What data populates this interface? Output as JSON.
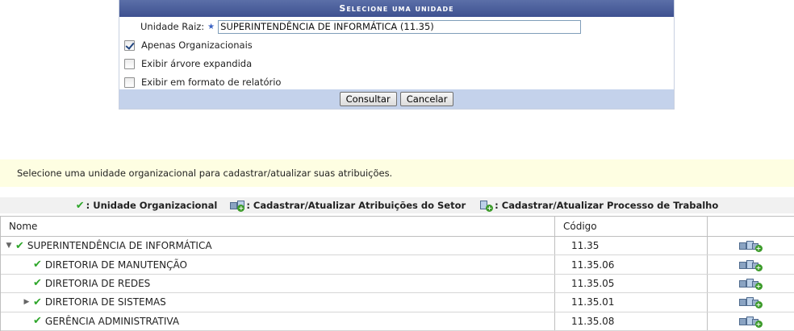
{
  "form": {
    "caption": "Selecione uma unidade",
    "root_label": "Unidade Raiz:",
    "required_mark": "★",
    "root_value": "SUPERINTENDÊNCIA DE INFORMÁTICA (11.35)",
    "options": [
      {
        "label": "Apenas Organizacionais",
        "checked": true
      },
      {
        "label": "Exibir árvore expandida",
        "checked": false
      },
      {
        "label": "Exibir em formato de relatório",
        "checked": false
      }
    ],
    "buttons": {
      "consult": "Consultar",
      "cancel": "Cancelar"
    }
  },
  "info": {
    "message": "Selecione uma unidade organizacional para cadastrar/atualizar suas atribuições."
  },
  "legend": {
    "org_unit": ": Unidade Organizacional",
    "sector_attr": ": Cadastrar/Atualizar Atribuições do Setor",
    "work_process": ": Cadastrar/Atualizar Processo de Trabalho"
  },
  "table": {
    "headers": {
      "name": "Nome",
      "code": "Código"
    },
    "rows": [
      {
        "expander": "▼",
        "name": "SUPERINTENDÊNCIA DE INFORMÁTICA",
        "code": "11.35",
        "level": 0
      },
      {
        "expander": "",
        "name": "DIRETORIA DE MANUTENÇÃO",
        "code": "11.35.06",
        "level": 1
      },
      {
        "expander": "",
        "name": "DIRETORIA DE REDES",
        "code": "11.35.05",
        "level": 1
      },
      {
        "expander": "▶",
        "name": "DIRETORIA DE SISTEMAS",
        "code": "11.35.01",
        "level": 1
      },
      {
        "expander": "",
        "name": "GERÊNCIA ADMINISTRATIVA",
        "code": "11.35.08",
        "level": 1
      }
    ]
  },
  "icons": {
    "check": "✔",
    "check_color": "#2ea62a",
    "header_color": "#3e5190",
    "info_bg": "#fefee2"
  }
}
